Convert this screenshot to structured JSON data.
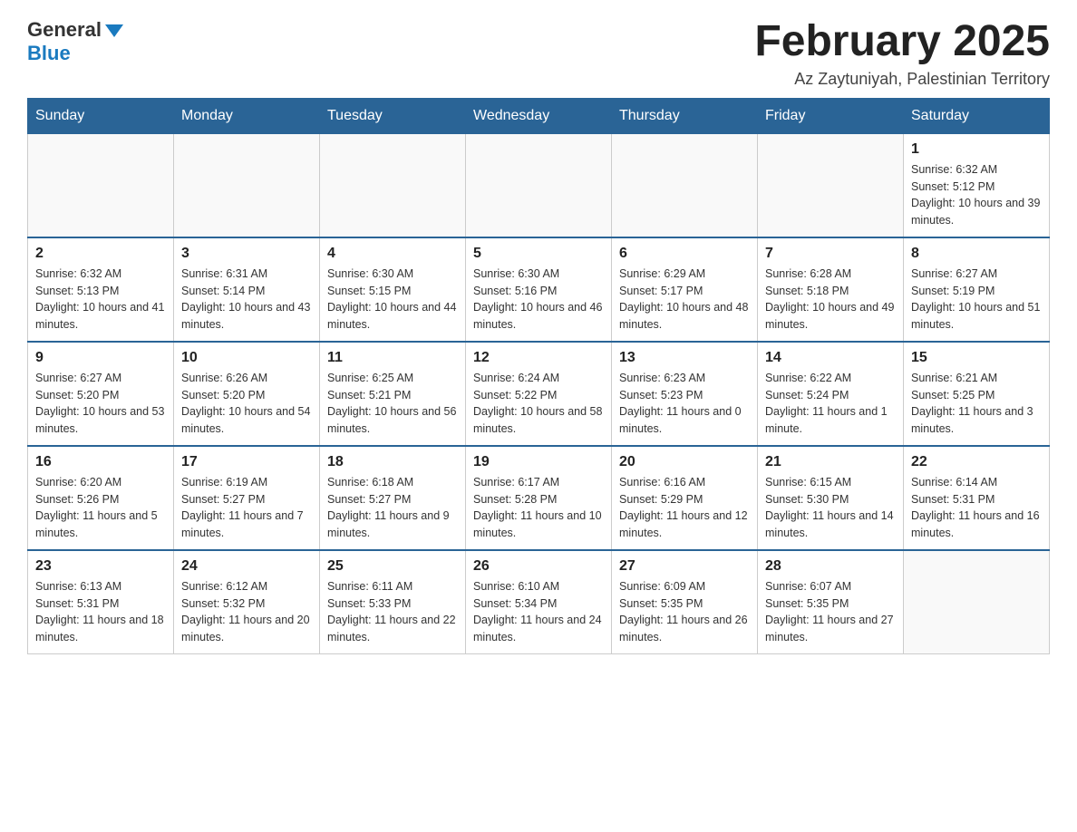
{
  "header": {
    "logo_general": "General",
    "logo_blue": "Blue",
    "month_title": "February 2025",
    "location": "Az Zaytuniyah, Palestinian Territory"
  },
  "days_of_week": [
    "Sunday",
    "Monday",
    "Tuesday",
    "Wednesday",
    "Thursday",
    "Friday",
    "Saturday"
  ],
  "weeks": [
    {
      "days": [
        {
          "number": "",
          "info": ""
        },
        {
          "number": "",
          "info": ""
        },
        {
          "number": "",
          "info": ""
        },
        {
          "number": "",
          "info": ""
        },
        {
          "number": "",
          "info": ""
        },
        {
          "number": "",
          "info": ""
        },
        {
          "number": "1",
          "info": "Sunrise: 6:32 AM\nSunset: 5:12 PM\nDaylight: 10 hours and 39 minutes."
        }
      ]
    },
    {
      "days": [
        {
          "number": "2",
          "info": "Sunrise: 6:32 AM\nSunset: 5:13 PM\nDaylight: 10 hours and 41 minutes."
        },
        {
          "number": "3",
          "info": "Sunrise: 6:31 AM\nSunset: 5:14 PM\nDaylight: 10 hours and 43 minutes."
        },
        {
          "number": "4",
          "info": "Sunrise: 6:30 AM\nSunset: 5:15 PM\nDaylight: 10 hours and 44 minutes."
        },
        {
          "number": "5",
          "info": "Sunrise: 6:30 AM\nSunset: 5:16 PM\nDaylight: 10 hours and 46 minutes."
        },
        {
          "number": "6",
          "info": "Sunrise: 6:29 AM\nSunset: 5:17 PM\nDaylight: 10 hours and 48 minutes."
        },
        {
          "number": "7",
          "info": "Sunrise: 6:28 AM\nSunset: 5:18 PM\nDaylight: 10 hours and 49 minutes."
        },
        {
          "number": "8",
          "info": "Sunrise: 6:27 AM\nSunset: 5:19 PM\nDaylight: 10 hours and 51 minutes."
        }
      ]
    },
    {
      "days": [
        {
          "number": "9",
          "info": "Sunrise: 6:27 AM\nSunset: 5:20 PM\nDaylight: 10 hours and 53 minutes."
        },
        {
          "number": "10",
          "info": "Sunrise: 6:26 AM\nSunset: 5:20 PM\nDaylight: 10 hours and 54 minutes."
        },
        {
          "number": "11",
          "info": "Sunrise: 6:25 AM\nSunset: 5:21 PM\nDaylight: 10 hours and 56 minutes."
        },
        {
          "number": "12",
          "info": "Sunrise: 6:24 AM\nSunset: 5:22 PM\nDaylight: 10 hours and 58 minutes."
        },
        {
          "number": "13",
          "info": "Sunrise: 6:23 AM\nSunset: 5:23 PM\nDaylight: 11 hours and 0 minutes."
        },
        {
          "number": "14",
          "info": "Sunrise: 6:22 AM\nSunset: 5:24 PM\nDaylight: 11 hours and 1 minute."
        },
        {
          "number": "15",
          "info": "Sunrise: 6:21 AM\nSunset: 5:25 PM\nDaylight: 11 hours and 3 minutes."
        }
      ]
    },
    {
      "days": [
        {
          "number": "16",
          "info": "Sunrise: 6:20 AM\nSunset: 5:26 PM\nDaylight: 11 hours and 5 minutes."
        },
        {
          "number": "17",
          "info": "Sunrise: 6:19 AM\nSunset: 5:27 PM\nDaylight: 11 hours and 7 minutes."
        },
        {
          "number": "18",
          "info": "Sunrise: 6:18 AM\nSunset: 5:27 PM\nDaylight: 11 hours and 9 minutes."
        },
        {
          "number": "19",
          "info": "Sunrise: 6:17 AM\nSunset: 5:28 PM\nDaylight: 11 hours and 10 minutes."
        },
        {
          "number": "20",
          "info": "Sunrise: 6:16 AM\nSunset: 5:29 PM\nDaylight: 11 hours and 12 minutes."
        },
        {
          "number": "21",
          "info": "Sunrise: 6:15 AM\nSunset: 5:30 PM\nDaylight: 11 hours and 14 minutes."
        },
        {
          "number": "22",
          "info": "Sunrise: 6:14 AM\nSunset: 5:31 PM\nDaylight: 11 hours and 16 minutes."
        }
      ]
    },
    {
      "days": [
        {
          "number": "23",
          "info": "Sunrise: 6:13 AM\nSunset: 5:31 PM\nDaylight: 11 hours and 18 minutes."
        },
        {
          "number": "24",
          "info": "Sunrise: 6:12 AM\nSunset: 5:32 PM\nDaylight: 11 hours and 20 minutes."
        },
        {
          "number": "25",
          "info": "Sunrise: 6:11 AM\nSunset: 5:33 PM\nDaylight: 11 hours and 22 minutes."
        },
        {
          "number": "26",
          "info": "Sunrise: 6:10 AM\nSunset: 5:34 PM\nDaylight: 11 hours and 24 minutes."
        },
        {
          "number": "27",
          "info": "Sunrise: 6:09 AM\nSunset: 5:35 PM\nDaylight: 11 hours and 26 minutes."
        },
        {
          "number": "28",
          "info": "Sunrise: 6:07 AM\nSunset: 5:35 PM\nDaylight: 11 hours and 27 minutes."
        },
        {
          "number": "",
          "info": ""
        }
      ]
    }
  ]
}
